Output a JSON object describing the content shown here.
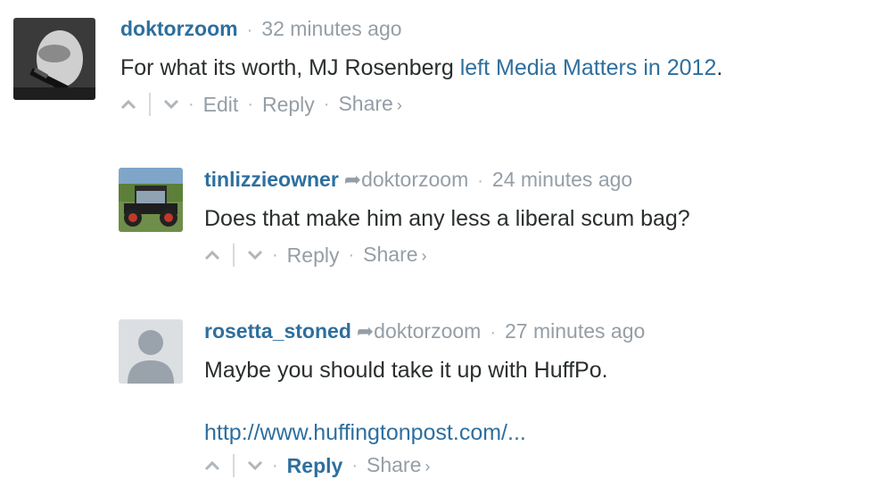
{
  "comments": [
    {
      "author": "doktorzoom",
      "time": "32 minutes ago",
      "text_before": "For what its worth, MJ Rosenberg ",
      "link_text": "left Media Matters in 2012",
      "text_after": ".",
      "actions": {
        "edit": "Edit",
        "reply": "Reply",
        "share": "Share"
      }
    },
    {
      "author": "tinlizzieowner",
      "reply_to": "doktorzoom",
      "time": "24 minutes ago",
      "text": "Does that make him any less a liberal scum bag?",
      "actions": {
        "reply": "Reply",
        "share": "Share"
      }
    },
    {
      "author": "rosetta_stoned",
      "reply_to": "doktorzoom",
      "time": "27 minutes ago",
      "text": "Maybe you should take it up with HuffPo.",
      "link": "http://www.huffingtonpost.com/...",
      "actions": {
        "reply": "Reply",
        "share": "Share"
      }
    }
  ],
  "icons": {
    "separator": "·",
    "share_chevron": "›",
    "reply_arrow": "➦"
  },
  "colors": {
    "author": "#2e6f9e",
    "meta": "#959ea6",
    "text": "#2a2e2e"
  }
}
